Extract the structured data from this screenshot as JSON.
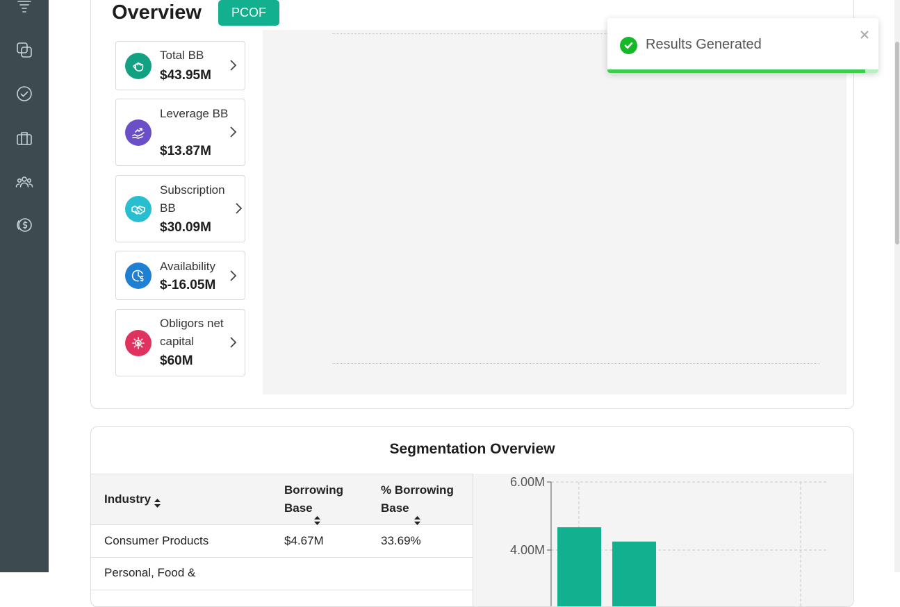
{
  "sidebar": {
    "items": [
      {
        "icon": "funnel-icon"
      },
      {
        "icon": "layers-icon"
      },
      {
        "icon": "check-circle-icon"
      },
      {
        "icon": "briefcase-icon"
      },
      {
        "icon": "users-icon"
      },
      {
        "icon": "dollar-coin-icon"
      }
    ]
  },
  "overview": {
    "title": "Overview",
    "badge": "PCOF",
    "metrics": [
      {
        "label": "Total BB",
        "value": "$43.95M",
        "color": "#12a183",
        "icon": "hand-coin-icon"
      },
      {
        "label": "Leverage BB",
        "value": "$13.87M",
        "color": "#6a4fc8",
        "icon": "growth-hand-icon"
      },
      {
        "label": "Subscription BB",
        "value": "$30.09M",
        "color": "#27bfcf",
        "icon": "handshake-icon"
      },
      {
        "label": "Availability",
        "value": "$-16.05M",
        "color": "#1f7fd1",
        "icon": "clock-dollar-icon"
      },
      {
        "label": "Obligors net capital",
        "value": "$60M",
        "color": "#e0325e",
        "icon": "gear-dollar-icon"
      }
    ]
  },
  "toast": {
    "message": "Results Generated",
    "progress": 0.95,
    "color": "#16b728"
  },
  "segmentation": {
    "title": "Segmentation Overview",
    "columns": [
      "Industry",
      "Borrowing Base",
      "% Borrowing Base"
    ],
    "rows": [
      {
        "industry": "Consumer Products",
        "borrowing_base": "$4.67M",
        "pct": "33.69%"
      },
      {
        "industry": "Personal, Food &",
        "borrowing_base": "",
        "pct": ""
      }
    ]
  },
  "chart_data": {
    "type": "bar",
    "ylim": [
      0,
      6000000
    ],
    "yticks": [
      "6.00M",
      "4.00M"
    ],
    "ytick_values": [
      6000000,
      4000000
    ],
    "values": [
      4670000,
      4250000
    ],
    "color": "#12b08f",
    "grid": true
  }
}
